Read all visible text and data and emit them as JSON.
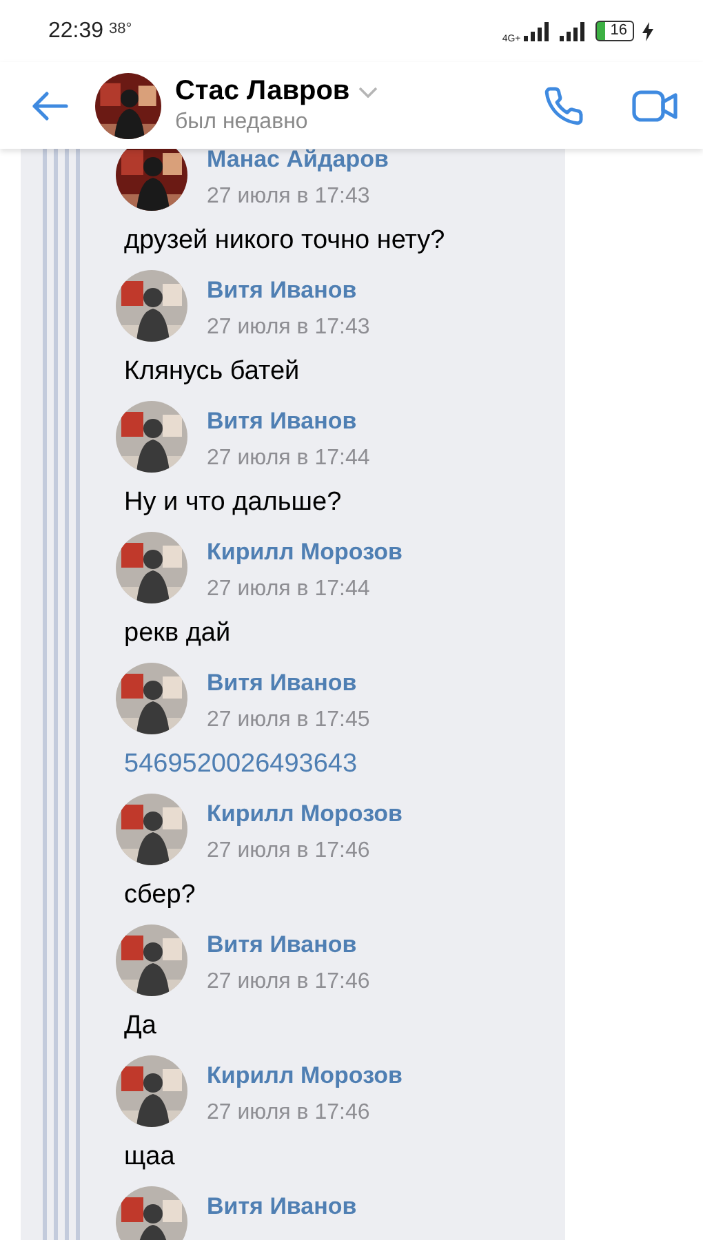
{
  "status_bar": {
    "time": "22:39",
    "temperature": "38°",
    "network": "4G+",
    "battery": "16"
  },
  "header": {
    "name": "Стас Лавров",
    "status": "был недавно"
  },
  "messages": [
    {
      "author": "Манас Айдаров",
      "date": "27 июля в 17:43",
      "body": {
        "kind": "text",
        "text": "друзей никого точно нету?"
      }
    },
    {
      "author": "Витя Иванов",
      "date": "27 июля в 17:43",
      "body": {
        "kind": "text",
        "text": "Клянусь батей"
      }
    },
    {
      "author": "Витя Иванов",
      "date": "27 июля в 17:44",
      "body": {
        "kind": "text",
        "text": "Ну и что дальше?"
      }
    },
    {
      "author": "Кирилл Морозов",
      "date": "27 июля в 17:44",
      "body": {
        "kind": "text",
        "text": "рекв дай"
      }
    },
    {
      "author": "Витя Иванов",
      "date": "27 июля в 17:45",
      "body": {
        "kind": "link",
        "text": "5469520026493643"
      }
    },
    {
      "author": "Кирилл Морозов",
      "date": "27 июля в 17:46",
      "body": {
        "kind": "text",
        "text": "сбер?"
      }
    },
    {
      "author": "Витя Иванов",
      "date": "27 июля в 17:46",
      "body": {
        "kind": "text",
        "text": "Да"
      }
    },
    {
      "author": "Кирилл Морозов",
      "date": "27 июля в 17:46",
      "body": {
        "kind": "text",
        "text": "щаа"
      }
    },
    {
      "author": "Витя Иванов"
    }
  ]
}
